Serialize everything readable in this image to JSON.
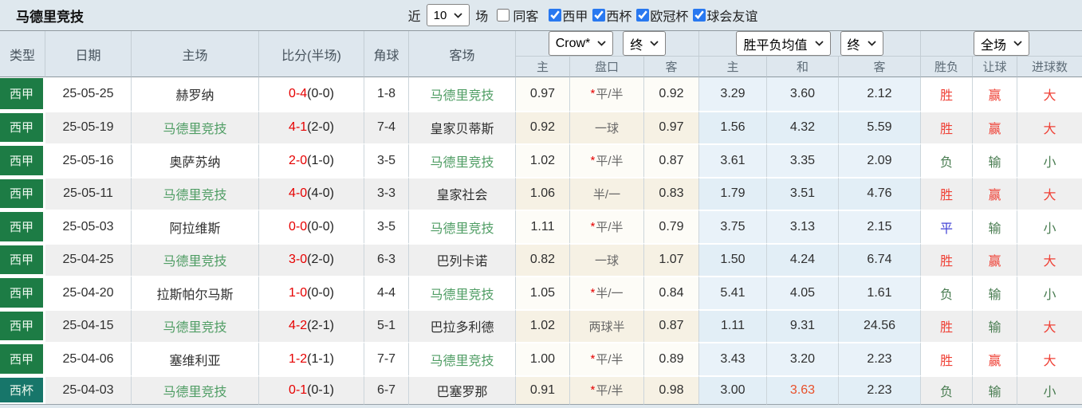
{
  "topbar": {
    "title": "马德里竞技",
    "recent_label": "近",
    "recent_value": "10",
    "matches_label": "场",
    "same_venue": {
      "label": "同客",
      "checked": false
    },
    "filters": [
      {
        "label": "西甲",
        "checked": true
      },
      {
        "label": "西杯",
        "checked": true
      },
      {
        "label": "欧冠杯",
        "checked": true
      },
      {
        "label": "球会友谊",
        "checked": true
      }
    ]
  },
  "table": {
    "columns": [
      "类型",
      "日期",
      "主场",
      "比分(半场)",
      "角球",
      "客场"
    ],
    "groups": {
      "handicap": {
        "bookmaker": "Crow*",
        "time": "终",
        "sub": [
          "主",
          "盘口",
          "客"
        ]
      },
      "avg": {
        "name": "胜平负均值",
        "time": "终",
        "sub": [
          "主",
          "和",
          "客"
        ]
      },
      "result": {
        "name": "全场",
        "sub": [
          "胜负",
          "让球",
          "进球数"
        ]
      }
    },
    "rows": [
      {
        "type": "西甲",
        "type_class": "liga",
        "date": "25-05-25",
        "home": "赫罗纳",
        "home_self": false,
        "score": "0-4",
        "half": "(0-0)",
        "corners": "1-8",
        "away": "马德里竞技",
        "away_self": true,
        "ah_home": "0.97",
        "ah_star": true,
        "ah_line": "平/半",
        "ah_away": "0.92",
        "avg_home": "3.29",
        "avg_draw": "3.60",
        "avg_away": "2.12",
        "avg_draw_hot": false,
        "result": "胜",
        "result_color": "red",
        "handicap_result": "赢",
        "handicap_result_color": "red",
        "goals": "大",
        "goals_color": "red"
      },
      {
        "type": "西甲",
        "type_class": "liga",
        "date": "25-05-19",
        "home": "马德里竞技",
        "home_self": true,
        "score": "4-1",
        "half": "(2-0)",
        "corners": "7-4",
        "away": "皇家贝蒂斯",
        "away_self": false,
        "ah_home": "0.92",
        "ah_star": false,
        "ah_line": "一球",
        "ah_away": "0.97",
        "avg_home": "1.56",
        "avg_draw": "4.32",
        "avg_away": "5.59",
        "avg_draw_hot": false,
        "result": "胜",
        "result_color": "red",
        "handicap_result": "赢",
        "handicap_result_color": "red",
        "goals": "大",
        "goals_color": "red"
      },
      {
        "type": "西甲",
        "type_class": "liga",
        "date": "25-05-16",
        "home": "奥萨苏纳",
        "home_self": false,
        "score": "2-0",
        "half": "(1-0)",
        "corners": "3-5",
        "away": "马德里竞技",
        "away_self": true,
        "ah_home": "1.02",
        "ah_star": true,
        "ah_line": "平/半",
        "ah_away": "0.87",
        "avg_home": "3.61",
        "avg_draw": "3.35",
        "avg_away": "2.09",
        "avg_draw_hot": false,
        "result": "负",
        "result_color": "green",
        "handicap_result": "输",
        "handicap_result_color": "green",
        "goals": "小",
        "goals_color": "green"
      },
      {
        "type": "西甲",
        "type_class": "liga",
        "date": "25-05-11",
        "home": "马德里竞技",
        "home_self": true,
        "score": "4-0",
        "half": "(4-0)",
        "corners": "3-3",
        "away": "皇家社会",
        "away_self": false,
        "ah_home": "1.06",
        "ah_star": false,
        "ah_line": "半/一",
        "ah_away": "0.83",
        "avg_home": "1.79",
        "avg_draw": "3.51",
        "avg_away": "4.76",
        "avg_draw_hot": false,
        "result": "胜",
        "result_color": "red",
        "handicap_result": "赢",
        "handicap_result_color": "red",
        "goals": "大",
        "goals_color": "red"
      },
      {
        "type": "西甲",
        "type_class": "liga",
        "date": "25-05-03",
        "home": "阿拉维斯",
        "home_self": false,
        "score": "0-0",
        "half": "(0-0)",
        "corners": "3-5",
        "away": "马德里竞技",
        "away_self": true,
        "ah_home": "1.11",
        "ah_star": true,
        "ah_line": "平/半",
        "ah_away": "0.79",
        "avg_home": "3.75",
        "avg_draw": "3.13",
        "avg_away": "2.15",
        "avg_draw_hot": false,
        "result": "平",
        "result_color": "blue",
        "handicap_result": "输",
        "handicap_result_color": "green",
        "goals": "小",
        "goals_color": "green"
      },
      {
        "type": "西甲",
        "type_class": "liga",
        "date": "25-04-25",
        "home": "马德里竞技",
        "home_self": true,
        "score": "3-0",
        "half": "(2-0)",
        "corners": "6-3",
        "away": "巴列卡诺",
        "away_self": false,
        "ah_home": "0.82",
        "ah_star": false,
        "ah_line": "一球",
        "ah_away": "1.07",
        "avg_home": "1.50",
        "avg_draw": "4.24",
        "avg_away": "6.74",
        "avg_draw_hot": false,
        "result": "胜",
        "result_color": "red",
        "handicap_result": "赢",
        "handicap_result_color": "red",
        "goals": "大",
        "goals_color": "red"
      },
      {
        "type": "西甲",
        "type_class": "liga",
        "date": "25-04-20",
        "home": "拉斯帕尔马斯",
        "home_self": false,
        "score": "1-0",
        "half": "(0-0)",
        "corners": "4-4",
        "away": "马德里竞技",
        "away_self": true,
        "ah_home": "1.05",
        "ah_star": true,
        "ah_line": "半/一",
        "ah_away": "0.84",
        "avg_home": "5.41",
        "avg_draw": "4.05",
        "avg_away": "1.61",
        "avg_draw_hot": false,
        "result": "负",
        "result_color": "green",
        "handicap_result": "输",
        "handicap_result_color": "green",
        "goals": "小",
        "goals_color": "green"
      },
      {
        "type": "西甲",
        "type_class": "liga",
        "date": "25-04-15",
        "home": "马德里竞技",
        "home_self": true,
        "score": "4-2",
        "half": "(2-1)",
        "corners": "5-1",
        "away": "巴拉多利德",
        "away_self": false,
        "ah_home": "1.02",
        "ah_star": false,
        "ah_line": "两球半",
        "ah_away": "0.87",
        "avg_home": "1.11",
        "avg_draw": "9.31",
        "avg_away": "24.56",
        "avg_draw_hot": false,
        "result": "胜",
        "result_color": "red",
        "handicap_result": "输",
        "handicap_result_color": "green",
        "goals": "大",
        "goals_color": "red"
      },
      {
        "type": "西甲",
        "type_class": "liga",
        "date": "25-04-06",
        "home": "塞维利亚",
        "home_self": false,
        "score": "1-2",
        "half": "(1-1)",
        "corners": "7-7",
        "away": "马德里竞技",
        "away_self": true,
        "ah_home": "1.00",
        "ah_star": true,
        "ah_line": "平/半",
        "ah_away": "0.89",
        "avg_home": "3.43",
        "avg_draw": "3.20",
        "avg_away": "2.23",
        "avg_draw_hot": false,
        "result": "胜",
        "result_color": "red",
        "handicap_result": "赢",
        "handicap_result_color": "red",
        "goals": "大",
        "goals_color": "red"
      },
      {
        "type": "西杯",
        "type_class": "cup",
        "date": "25-04-03",
        "home": "马德里竞技",
        "home_self": true,
        "score": "0-1",
        "half": "(0-1)",
        "corners": "6-7",
        "away": "巴塞罗那",
        "away_self": false,
        "ah_home": "0.91",
        "ah_star": true,
        "ah_line": "平/半",
        "ah_away": "0.98",
        "avg_home": "3.00",
        "avg_draw": "3.63",
        "avg_away": "2.23",
        "avg_draw_hot": true,
        "result": "负",
        "result_color": "green",
        "handicap_result": "输",
        "handicap_result_color": "green",
        "goals": "小",
        "goals_color": "green"
      }
    ]
  },
  "colors": {
    "liga_badge": "#1d7c45",
    "cup_badge": "#17766a",
    "self_team_green": "#4f9d64",
    "score_red": "#e60000",
    "win_red": "#ef4136",
    "lose_green": "#4a7d52",
    "draw_blue": "#4343d6",
    "hot_orange": "#e8502a",
    "checkbox_blue": "#2878f0",
    "handicap_col_bg": "#f6f1e4",
    "avg_col_bg": "#e2eef6"
  }
}
